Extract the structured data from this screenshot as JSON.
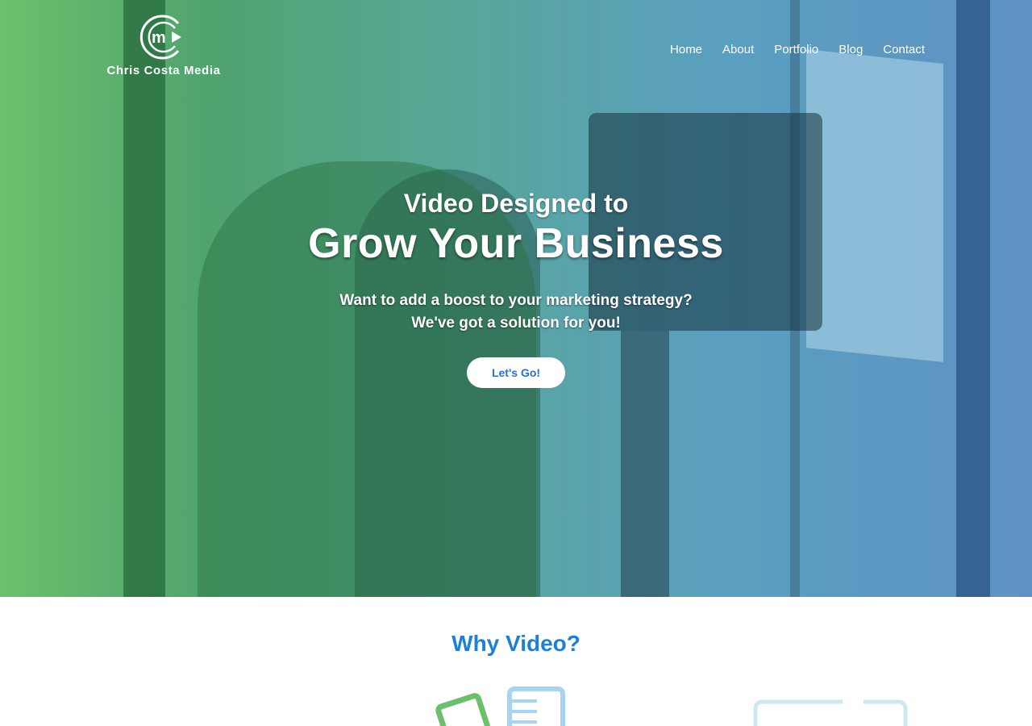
{
  "brand": {
    "name": "Chris Costa Media"
  },
  "nav": {
    "items": [
      "Home",
      "About",
      "Portfolio",
      "Blog",
      "Contact"
    ]
  },
  "hero": {
    "line1": "Video Designed to",
    "line2": "Grow Your Business",
    "sub1": "Want to add a boost to your marketing strategy?",
    "sub2": "We've got a solution for you!",
    "cta": "Let's Go!"
  },
  "why": {
    "title": "Why Video?"
  },
  "icons": {
    "logo": "cm-play-logo-icon",
    "feature1": "video-card-icon",
    "feature2": "device-frame-icon"
  },
  "colors": {
    "accent": "#1e7fd6",
    "green": "#6cc06c",
    "blue": "#5e92c4"
  }
}
